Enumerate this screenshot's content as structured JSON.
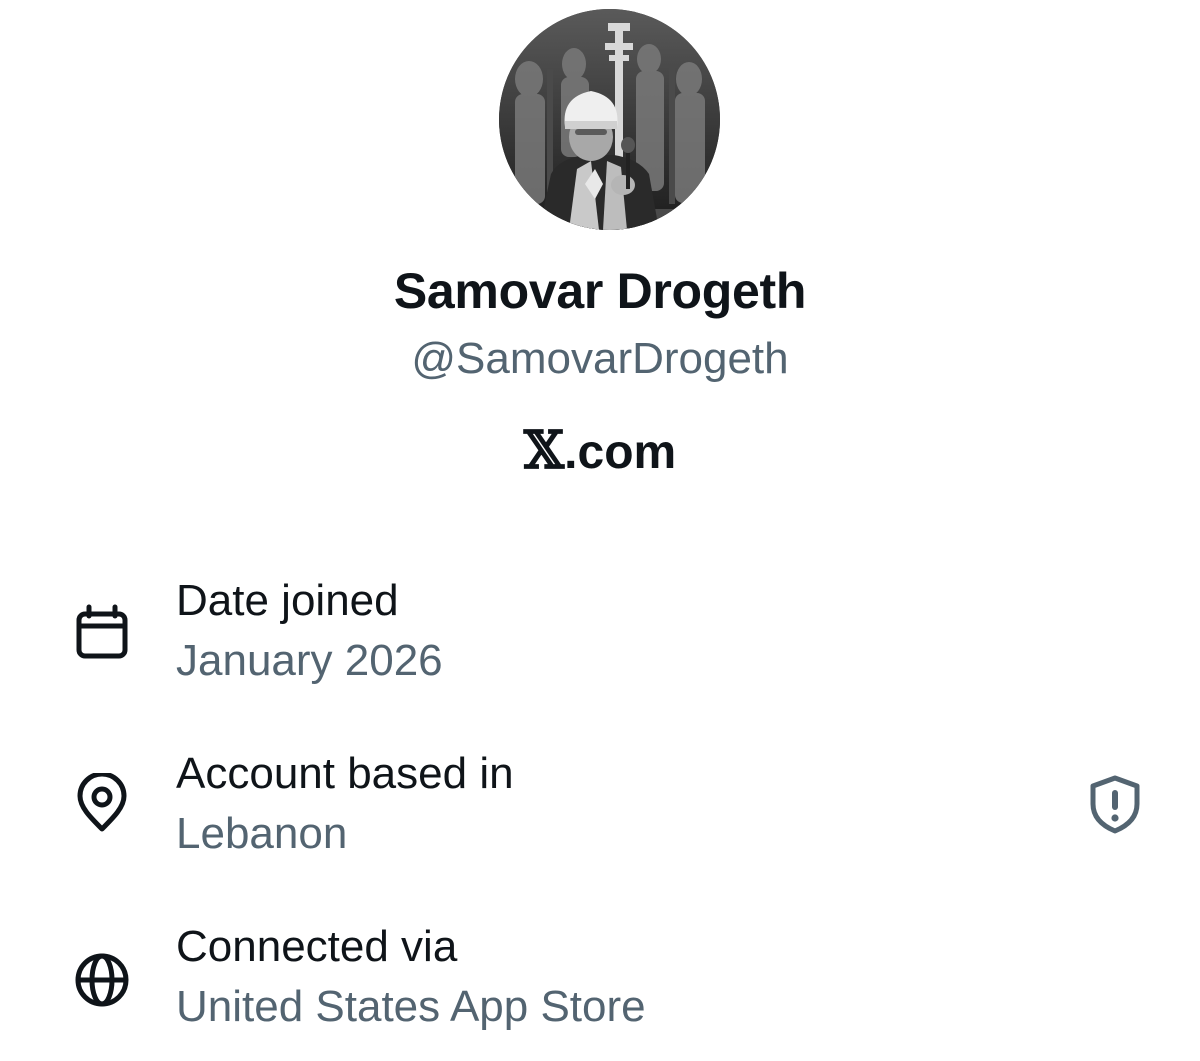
{
  "profile": {
    "display_name": "Samovar Drogeth",
    "handle": "@SamovarDrogeth",
    "site_mark": "𝕏",
    "site_suffix": ".com",
    "avatar_icon": "profile-photo"
  },
  "about": {
    "rows": [
      {
        "icon": "calendar-icon",
        "label": "Date joined",
        "value": "January 2026"
      },
      {
        "icon": "location-pin-icon",
        "label": "Account based in",
        "value": "Lebanon",
        "badge_icon": "shield-alert-icon"
      },
      {
        "icon": "globe-icon",
        "label": "Connected via",
        "value": "United States App Store"
      }
    ]
  },
  "colors": {
    "primary_text": "#0f1419",
    "secondary_text": "#536471"
  }
}
